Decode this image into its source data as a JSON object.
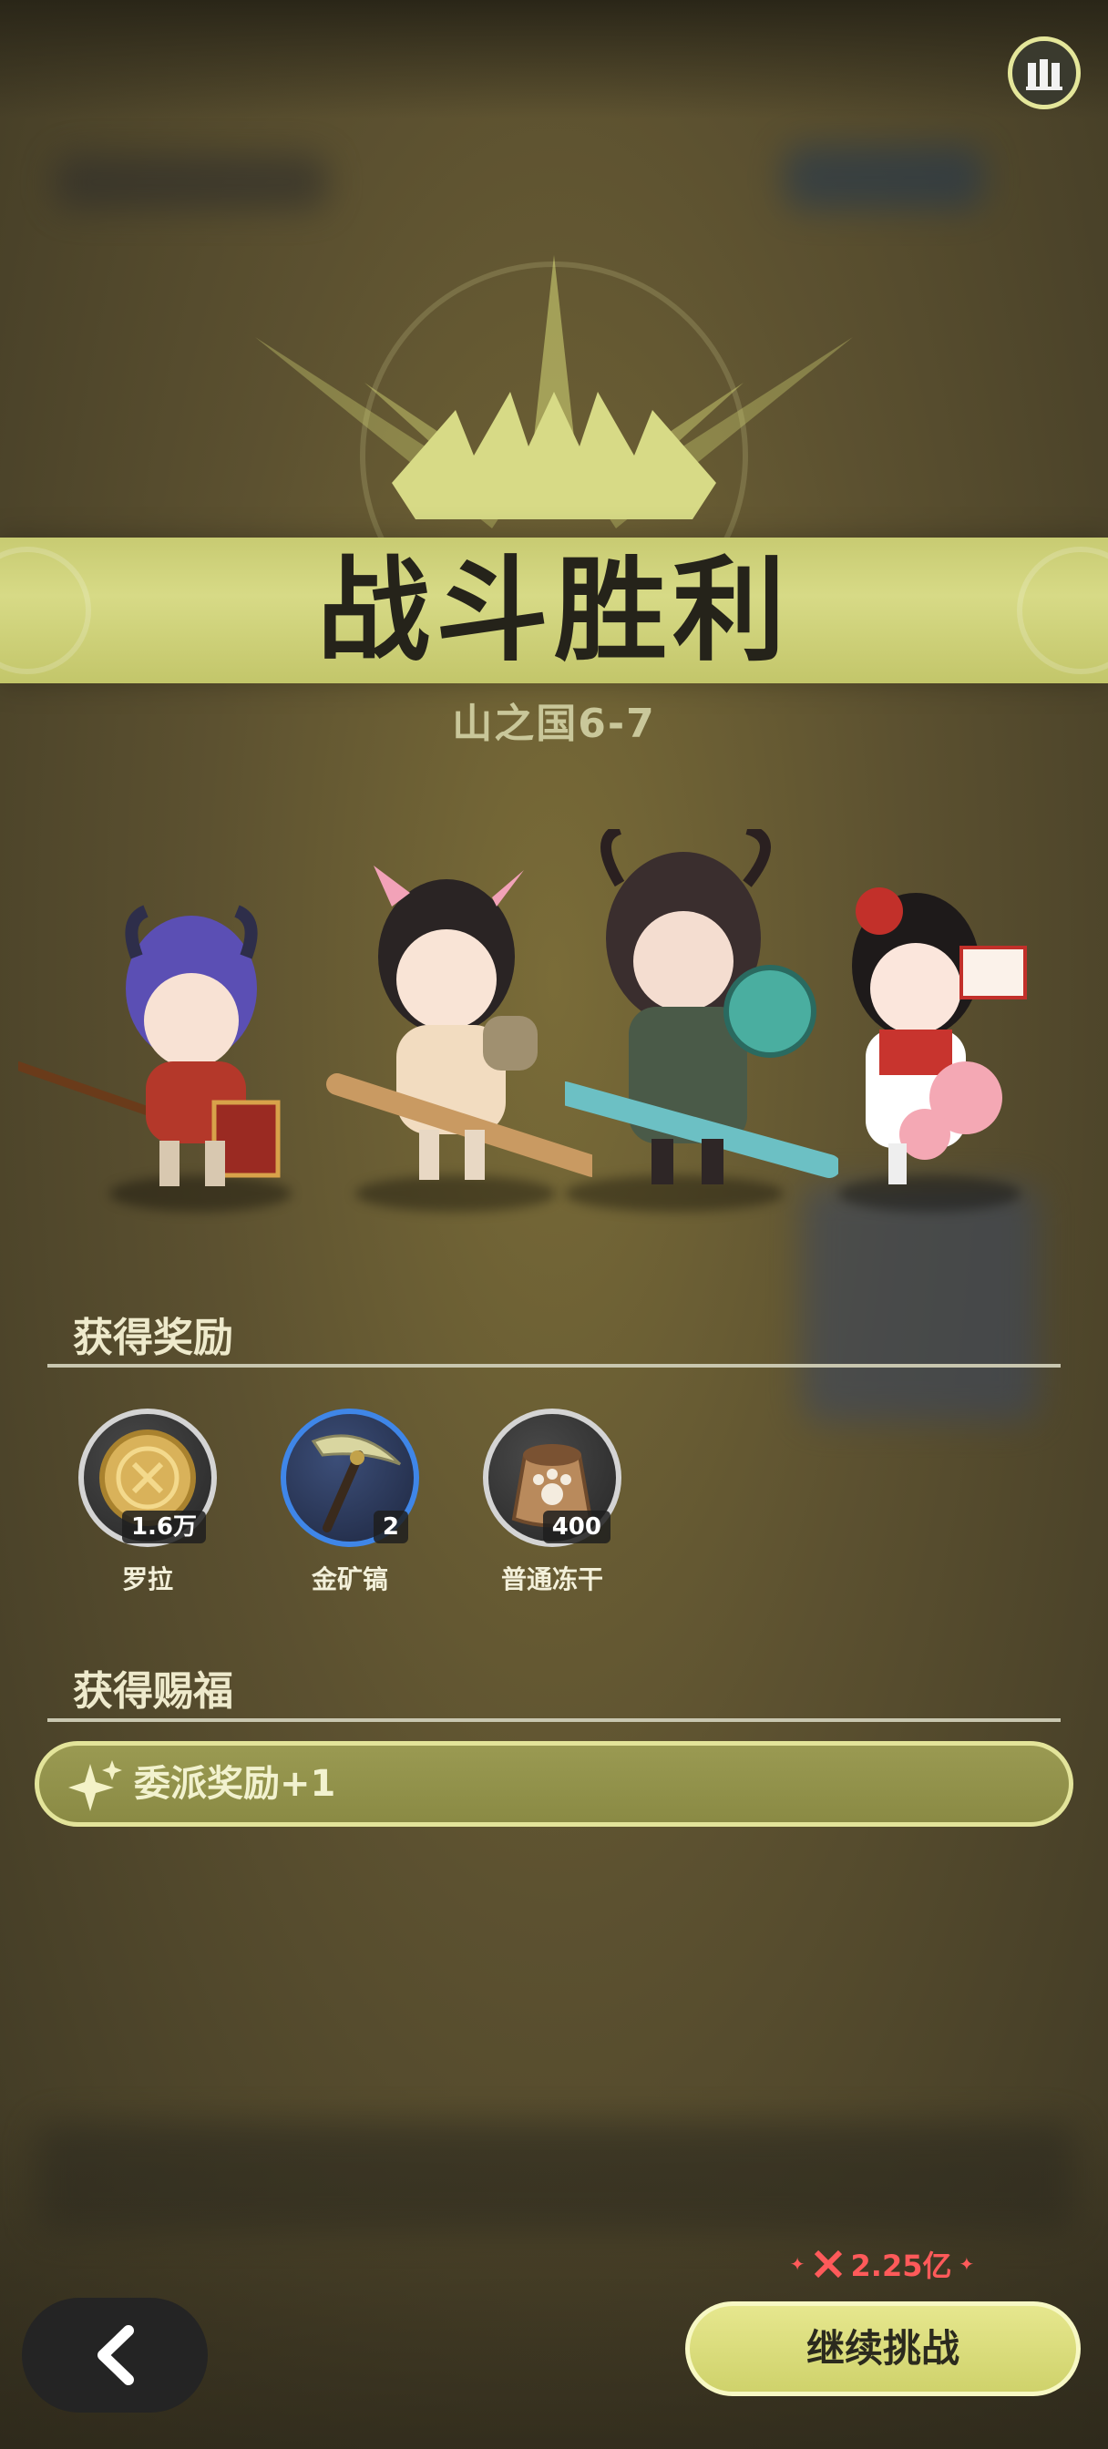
{
  "banner": {
    "title": "战斗胜利",
    "stage": "山之国6-7"
  },
  "icons": {
    "stats": "bar-chart-icon",
    "back": "chevron-left-icon",
    "blessing": "sparkle-icon",
    "power": "crossed-swords-icon"
  },
  "rewards_section": {
    "title": "获得奖励",
    "items": [
      {
        "name": "罗拉",
        "count": "1.6万",
        "icon": "gold-coin-icon"
      },
      {
        "name": "金矿镐",
        "count": "2",
        "icon": "pickaxe-icon"
      },
      {
        "name": "普通冻干",
        "count": "400",
        "icon": "food-sack-icon"
      }
    ]
  },
  "blessing_section": {
    "title": "获得赐福",
    "items": [
      {
        "label": "委派奖励+1"
      }
    ]
  },
  "footer": {
    "power_value": "2.25亿",
    "continue_label": "继续挑战"
  },
  "colors": {
    "accent": "#d7da86",
    "power": "#ff5a5a",
    "rare_border": "#3f86e8"
  }
}
